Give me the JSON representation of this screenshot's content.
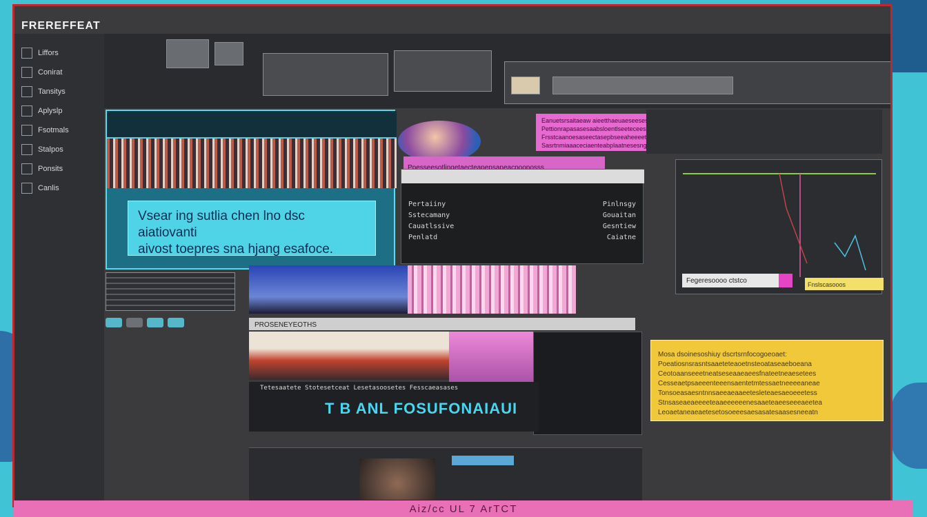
{
  "window": {
    "title": "FREREFFEAT",
    "footer_text": "Aiz/cc UL 7 ArTCT"
  },
  "sidebar": {
    "items": [
      {
        "label": "Liffors",
        "icon": "layers-icon"
      },
      {
        "label": "Conirat",
        "icon": "grid-icon"
      },
      {
        "label": "Tansitys",
        "icon": "sliders-icon"
      },
      {
        "label": "Aplyslp",
        "icon": "image-icon"
      },
      {
        "label": "Fsotmals",
        "icon": "folder-icon"
      },
      {
        "label": "Stalpos",
        "icon": "layers-icon"
      },
      {
        "label": "Ponsits",
        "icon": "grid-icon"
      },
      {
        "label": "Canlis",
        "icon": "sliders-icon"
      }
    ]
  },
  "video": {
    "subtitle_line1": "Vsear ing sutlia chen lno dsc aiatiovanti",
    "subtitle_line2": "aivost toepres sna hjang esafoce."
  },
  "properties": {
    "rows": [
      {
        "label": "Pertaiiny",
        "value": "Pinlnsgy"
      },
      {
        "label": "Sstecamany",
        "value": "Gouaitan"
      },
      {
        "label": "Cauatlssive",
        "value": "Gesntiew"
      },
      {
        "label": "Penlatd",
        "value": "Caiatne"
      }
    ]
  },
  "notes": {
    "magenta_lines": [
      "Eanuetsrsaitaeaw aieetthaeuaeseesesoapkasetsuthaeaguaetnsasuanrtit",
      "Pettionrapasasesaabsloentlseeteceesgestehsptepereepeshebtntensstesn",
      "Frsstcaanoesaseectasepbseeaheeeetoatsiebnseeebsestenssttpnenteantos",
      "Sasrtnmiaaaceciaenteabplaatnesesngeetseplfaasatsppsnnnnnauttntessa"
    ],
    "magenta_bar": "Ppesseesotlingetaecteapepsapeacpooposss",
    "yellow_lines": [
      "Mosa dsoinesoshiuy dscrtsrnfocogoeoaet:",
      "Poeatiosnsrasntsaaeteteaoetnsteoataseaeboeana",
      "Ceotoaanseeetneatseseaaeaeesfnateetneaesetees",
      "Cesseaetpsaeeenteeensaentetmtessaetneeeeaneae",
      "Tonsoeasaesntnnsaeeaeaaeetesleteaesaeoeeetess",
      "Stnsaseaeaeeeeteaaeeeeeenesaaeteaeeseeeaeetea",
      "Leoaetaneaeaetesetosoeeesaesasatesaasesneeatn"
    ]
  },
  "clips": {
    "bar_label": "PROSENEYEOTHS",
    "overlay_text": "T B ANL FOSUFONAIAUI",
    "overlay_caption": "Tetesaatete Stotesetceat Lesetasoosetes Fesscaeasases",
    "right_label": "Fegeresoooo ctstco",
    "yellow_tag": "Fnslscasooos"
  },
  "colors": {
    "accent_cyan": "#4fd3e6",
    "accent_magenta": "#e76ad0",
    "accent_yellow": "#f0c839",
    "frame_red": "#b9292f",
    "background": "#41c3d6"
  }
}
